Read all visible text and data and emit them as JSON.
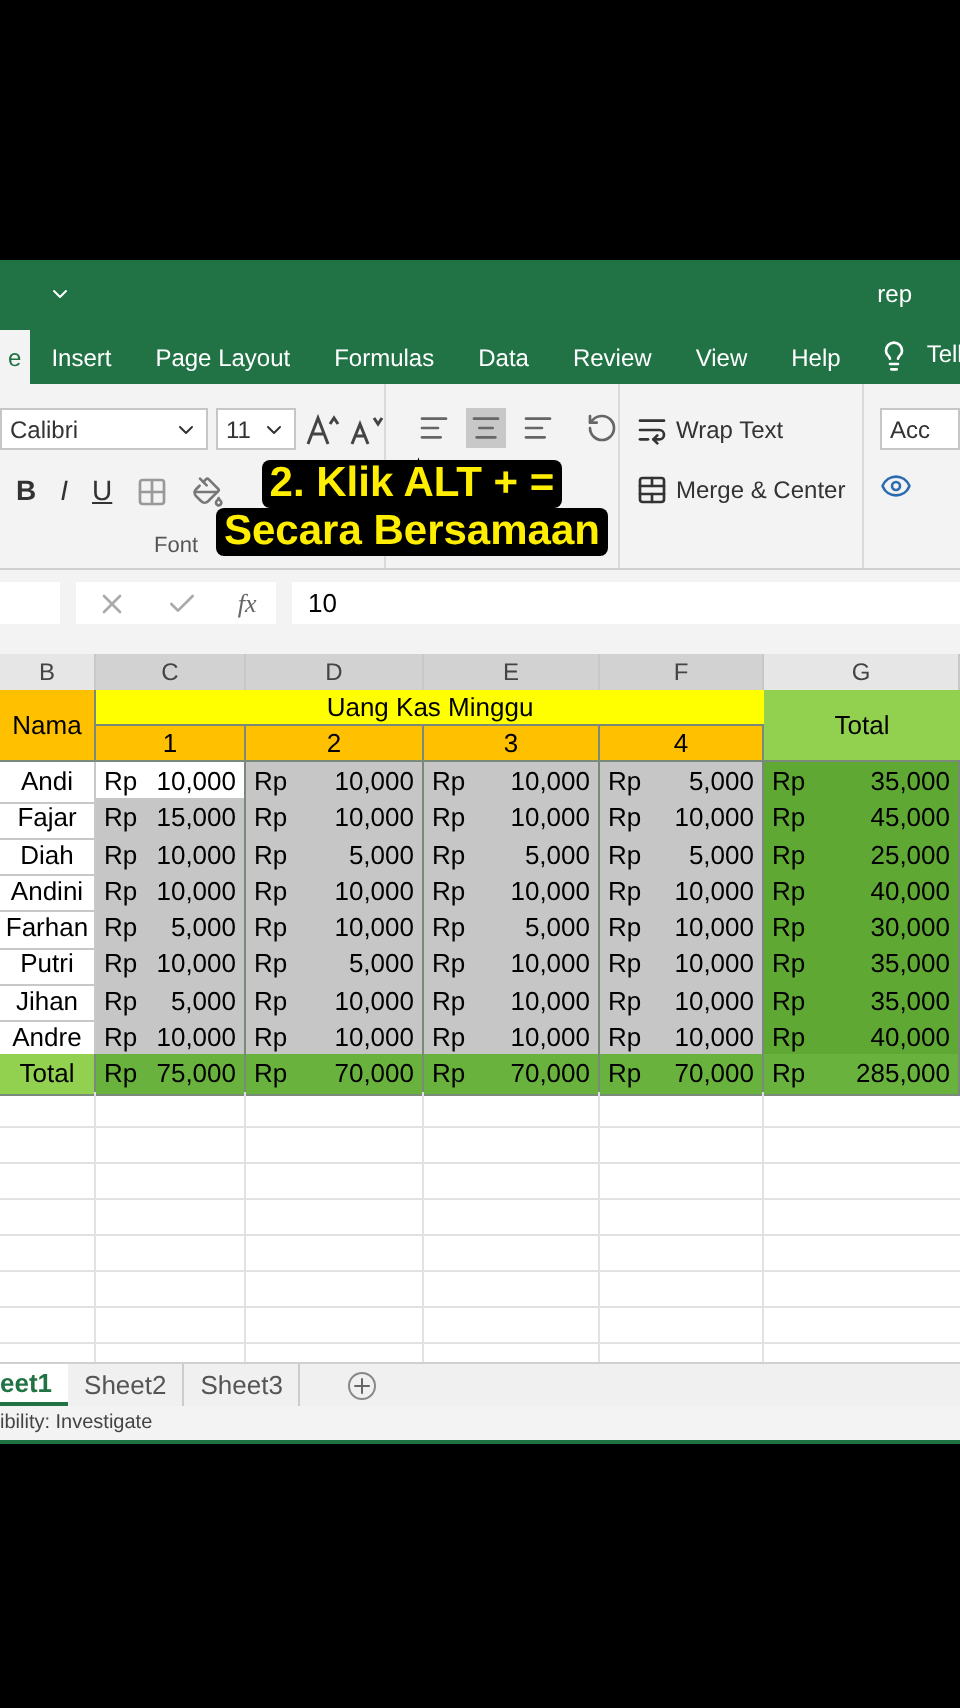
{
  "window": {
    "title": "rep"
  },
  "tabs": [
    {
      "label": "e",
      "selected": true
    },
    {
      "label": "Insert",
      "selected": false
    },
    {
      "label": "Page Layout",
      "selected": false
    },
    {
      "label": "Formulas",
      "selected": false
    },
    {
      "label": "Data",
      "selected": false
    },
    {
      "label": "Review",
      "selected": false
    },
    {
      "label": "View",
      "selected": false
    },
    {
      "label": "Help",
      "selected": false
    }
  ],
  "tell_me": "Tell",
  "ribbon": {
    "font_name": "Calibri",
    "font_size": "11",
    "format_buttons": [
      "B",
      "I",
      "U"
    ],
    "font_group_label": "Font",
    "wrap_text": "Wrap Text",
    "merge_center": "Merge & Center",
    "style_box": "Acc"
  },
  "caption": [
    "2. Klik ALT + =",
    "Secara Bersamaan"
  ],
  "formula_bar": {
    "fx_label": "fx",
    "value": "10"
  },
  "columns": [
    "B",
    "C",
    "D",
    "E",
    "F",
    "G"
  ],
  "table": {
    "name_header": "Nama",
    "group_header": "Uang Kas Minggu",
    "week_headers": [
      "1",
      "2",
      "3",
      "4"
    ],
    "total_header": "Total",
    "rows": [
      {
        "name": "Andi",
        "weeks": [
          {
            "currency": "Rp",
            "value": "10,000",
            "active": true
          },
          {
            "currency": "Rp",
            "value": "10,000",
            "active": false
          },
          {
            "currency": "Rp",
            "value": "10,000",
            "active": false
          },
          {
            "currency": "Rp",
            "value": "5,000",
            "active": false
          }
        ],
        "total": {
          "currency": "Rp",
          "value": "35,000"
        }
      },
      {
        "name": "Fajar",
        "weeks": [
          {
            "currency": "Rp",
            "value": "15,000",
            "active": false
          },
          {
            "currency": "Rp",
            "value": "10,000",
            "active": false
          },
          {
            "currency": "Rp",
            "value": "10,000",
            "active": false
          },
          {
            "currency": "Rp",
            "value": "10,000",
            "active": false
          }
        ],
        "total": {
          "currency": "Rp",
          "value": "45,000"
        }
      },
      {
        "name": "Diah",
        "weeks": [
          {
            "currency": "Rp",
            "value": "10,000",
            "active": false
          },
          {
            "currency": "Rp",
            "value": "5,000",
            "active": false
          },
          {
            "currency": "Rp",
            "value": "5,000",
            "active": false
          },
          {
            "currency": "Rp",
            "value": "5,000",
            "active": false
          }
        ],
        "total": {
          "currency": "Rp",
          "value": "25,000"
        }
      },
      {
        "name": "Andini",
        "weeks": [
          {
            "currency": "Rp",
            "value": "10,000",
            "active": false
          },
          {
            "currency": "Rp",
            "value": "10,000",
            "active": false
          },
          {
            "currency": "Rp",
            "value": "10,000",
            "active": false
          },
          {
            "currency": "Rp",
            "value": "10,000",
            "active": false
          }
        ],
        "total": {
          "currency": "Rp",
          "value": "40,000"
        }
      },
      {
        "name": "Farhan",
        "weeks": [
          {
            "currency": "Rp",
            "value": "5,000",
            "active": false
          },
          {
            "currency": "Rp",
            "value": "10,000",
            "active": false
          },
          {
            "currency": "Rp",
            "value": "5,000",
            "active": false
          },
          {
            "currency": "Rp",
            "value": "10,000",
            "active": false
          }
        ],
        "total": {
          "currency": "Rp",
          "value": "30,000"
        }
      },
      {
        "name": "Putri",
        "weeks": [
          {
            "currency": "Rp",
            "value": "10,000",
            "active": false
          },
          {
            "currency": "Rp",
            "value": "5,000",
            "active": false
          },
          {
            "currency": "Rp",
            "value": "10,000",
            "active": false
          },
          {
            "currency": "Rp",
            "value": "10,000",
            "active": false
          }
        ],
        "total": {
          "currency": "Rp",
          "value": "35,000"
        }
      },
      {
        "name": "Jihan",
        "weeks": [
          {
            "currency": "Rp",
            "value": "5,000",
            "active": false
          },
          {
            "currency": "Rp",
            "value": "10,000",
            "active": false
          },
          {
            "currency": "Rp",
            "value": "10,000",
            "active": false
          },
          {
            "currency": "Rp",
            "value": "10,000",
            "active": false
          }
        ],
        "total": {
          "currency": "Rp",
          "value": "35,000"
        }
      },
      {
        "name": "Andre",
        "weeks": [
          {
            "currency": "Rp",
            "value": "10,000",
            "active": false
          },
          {
            "currency": "Rp",
            "value": "10,000",
            "active": false
          },
          {
            "currency": "Rp",
            "value": "10,000",
            "active": false
          },
          {
            "currency": "Rp",
            "value": "10,000",
            "active": false
          }
        ],
        "total": {
          "currency": "Rp",
          "value": "40,000"
        }
      }
    ],
    "total_row": {
      "label": "Total",
      "weeks": [
        {
          "currency": "Rp",
          "value": "75,000"
        },
        {
          "currency": "Rp",
          "value": "70,000"
        },
        {
          "currency": "Rp",
          "value": "70,000"
        },
        {
          "currency": "Rp",
          "value": "70,000"
        }
      ],
      "total": {
        "currency": "Rp",
        "value": "285,000"
      }
    }
  },
  "sheets": [
    {
      "label": "eet1",
      "selected": true
    },
    {
      "label": "Sheet2",
      "selected": false
    },
    {
      "label": "Sheet3",
      "selected": false
    }
  ],
  "status_bar": "ibility: Investigate"
}
